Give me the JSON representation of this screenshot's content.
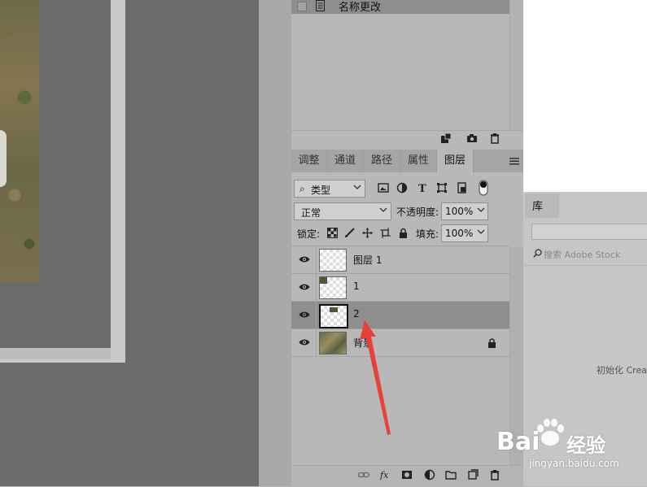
{
  "history": {
    "items": [
      {
        "label": "名称更改"
      }
    ]
  },
  "tabs": [
    {
      "label": "调整"
    },
    {
      "label": "通道"
    },
    {
      "label": "路径"
    },
    {
      "label": "属性"
    },
    {
      "label": "图层",
      "active": true
    }
  ],
  "layers_panel": {
    "filter_kind": "类型",
    "blend_mode": "正常",
    "opacity_label": "不透明度:",
    "opacity_value": "100%",
    "lock_label": "锁定:",
    "fill_label": "填充:",
    "fill_value": "100%",
    "layers": [
      {
        "name": "图层 1",
        "visible": true,
        "selected": false,
        "locked": false
      },
      {
        "name": "1",
        "visible": true,
        "selected": false,
        "locked": false
      },
      {
        "name": "2",
        "visible": true,
        "selected": true,
        "locked": false
      },
      {
        "name": "背景",
        "visible": true,
        "selected": false,
        "locked": true
      }
    ]
  },
  "library": {
    "tab_label": "库",
    "search_placeholder": "搜索 Adobe Stock",
    "status": "初始化 Crea"
  },
  "watermark": {
    "brand": "Bai",
    "brand_du": "经验",
    "url": "jingyan.baidu.com"
  },
  "colors": {
    "selected_row": "#8e8e8e",
    "arrow": "#e8403a"
  }
}
